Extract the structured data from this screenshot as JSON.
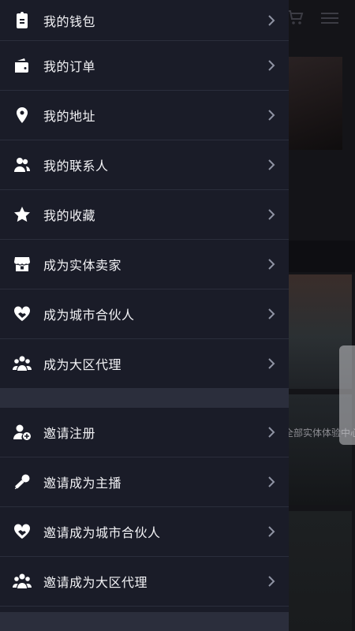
{
  "drawer": {
    "group1": [
      {
        "icon": "wallet-clipboard-icon",
        "label": "我的钱包"
      },
      {
        "icon": "order-wallet-icon",
        "label": "我的订单"
      },
      {
        "icon": "location-pin-icon",
        "label": "我的地址"
      },
      {
        "icon": "contacts-icon",
        "label": "我的联系人"
      },
      {
        "icon": "star-icon",
        "label": "我的收藏"
      },
      {
        "icon": "store-icon",
        "label": "成为实体卖家"
      },
      {
        "icon": "handshake-heart-icon",
        "label": "成为城市合伙人"
      },
      {
        "icon": "group-icon",
        "label": "成为大区代理"
      }
    ],
    "group2": [
      {
        "icon": "add-user-icon",
        "label": "邀请注册"
      },
      {
        "icon": "microphone-icon",
        "label": "邀请成为主播"
      },
      {
        "icon": "handshake-heart-icon",
        "label": "邀请成为城市合伙人"
      },
      {
        "icon": "group-icon",
        "label": "邀请成为大区代理"
      }
    ]
  },
  "background": {
    "caption": "全部实体体验中心"
  },
  "colors": {
    "drawer_bg": "#1a1c28",
    "divider": "#2b2e3c",
    "text": "#f2f2f5",
    "chevron": "#8f93a3"
  }
}
